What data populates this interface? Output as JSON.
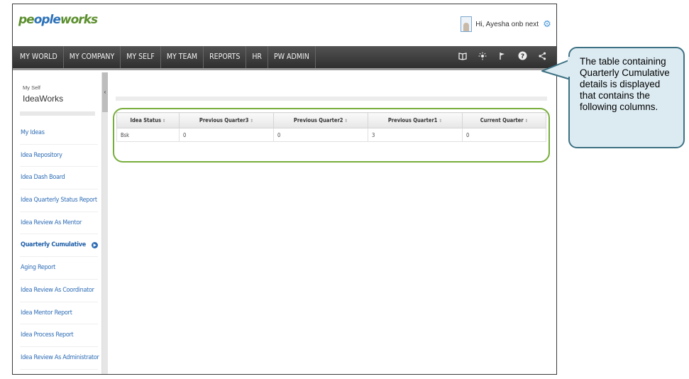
{
  "header": {
    "logo_part1": "pe",
    "logo_part2": "ople",
    "logo_part3": "works",
    "greeting": "Hi, Ayesha onb next",
    "settings_icon": "gear-icon",
    "avatar_icon": "user-avatar-icon"
  },
  "nav": {
    "items": [
      {
        "label": "MY WORLD"
      },
      {
        "label": "MY COMPANY"
      },
      {
        "label": "MY SELF"
      },
      {
        "label": "MY TEAM"
      },
      {
        "label": "REPORTS"
      },
      {
        "label": "HR"
      },
      {
        "label": "PW ADMIN"
      }
    ],
    "icons": [
      "book-icon",
      "lightbulb-icon",
      "flag-icon",
      "help-icon",
      "share-icon"
    ]
  },
  "sidebar": {
    "breadcrumb_small": "My Self",
    "title": "IdeaWorks",
    "items": [
      {
        "label": "My Ideas",
        "active": false
      },
      {
        "label": "Idea Repository",
        "active": false
      },
      {
        "label": "Idea Dash Board",
        "active": false
      },
      {
        "label": "Idea Quarterly Status Report",
        "active": false
      },
      {
        "label": "Idea Review As Mentor",
        "active": false
      },
      {
        "label": "Quarterly Cumulative",
        "active": true
      },
      {
        "label": "Aging Report",
        "active": false
      },
      {
        "label": "Idea Review As Coordinator",
        "active": false
      },
      {
        "label": "Idea Mentor Report",
        "active": false
      },
      {
        "label": "Idea Process Report",
        "active": false
      },
      {
        "label": "Idea Review As Administrator",
        "active": false
      }
    ],
    "collapse_glyph": "‹"
  },
  "table": {
    "columns": [
      "Idea Status",
      "Previous Quarter3",
      "Previous Quarter2",
      "Previous Quarter1",
      "Current Quarter"
    ],
    "rows": [
      [
        "Bsk",
        "0",
        "0",
        "3",
        "0"
      ]
    ]
  },
  "callout": {
    "text": "The table containing Quarterly Cumulative details is displayed that contains the following columns."
  },
  "colors": {
    "nav_bg": "#3f3f3f",
    "link": "#2d6cb5",
    "highlight_border": "#78ad3c",
    "callout_bg": "#dcebf2",
    "callout_border": "#3d7183"
  }
}
